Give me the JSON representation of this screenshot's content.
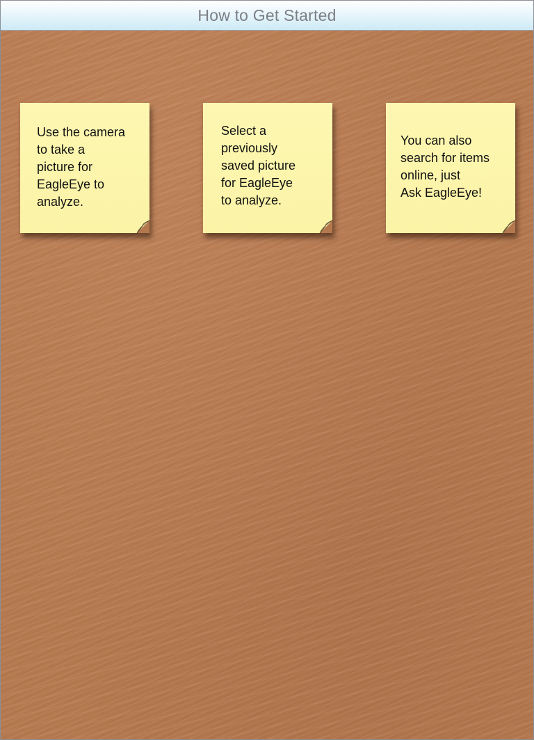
{
  "navigation_bar": {
    "title": "How to Get Started"
  },
  "notes": [
    {
      "text": "Use the camera\nto take a\npicture for\nEagleEye to\nanalyze."
    },
    {
      "text": "Select a\npreviously\nsaved picture\nfor EagleEye\nto analyze."
    },
    {
      "text": "You can also\nsearch for items\nonline, just\nAsk EagleEye!"
    }
  ],
  "colors": {
    "background": "#b4784f",
    "note_paper": "#fdf7b2",
    "title_text": "#7b7f83"
  }
}
